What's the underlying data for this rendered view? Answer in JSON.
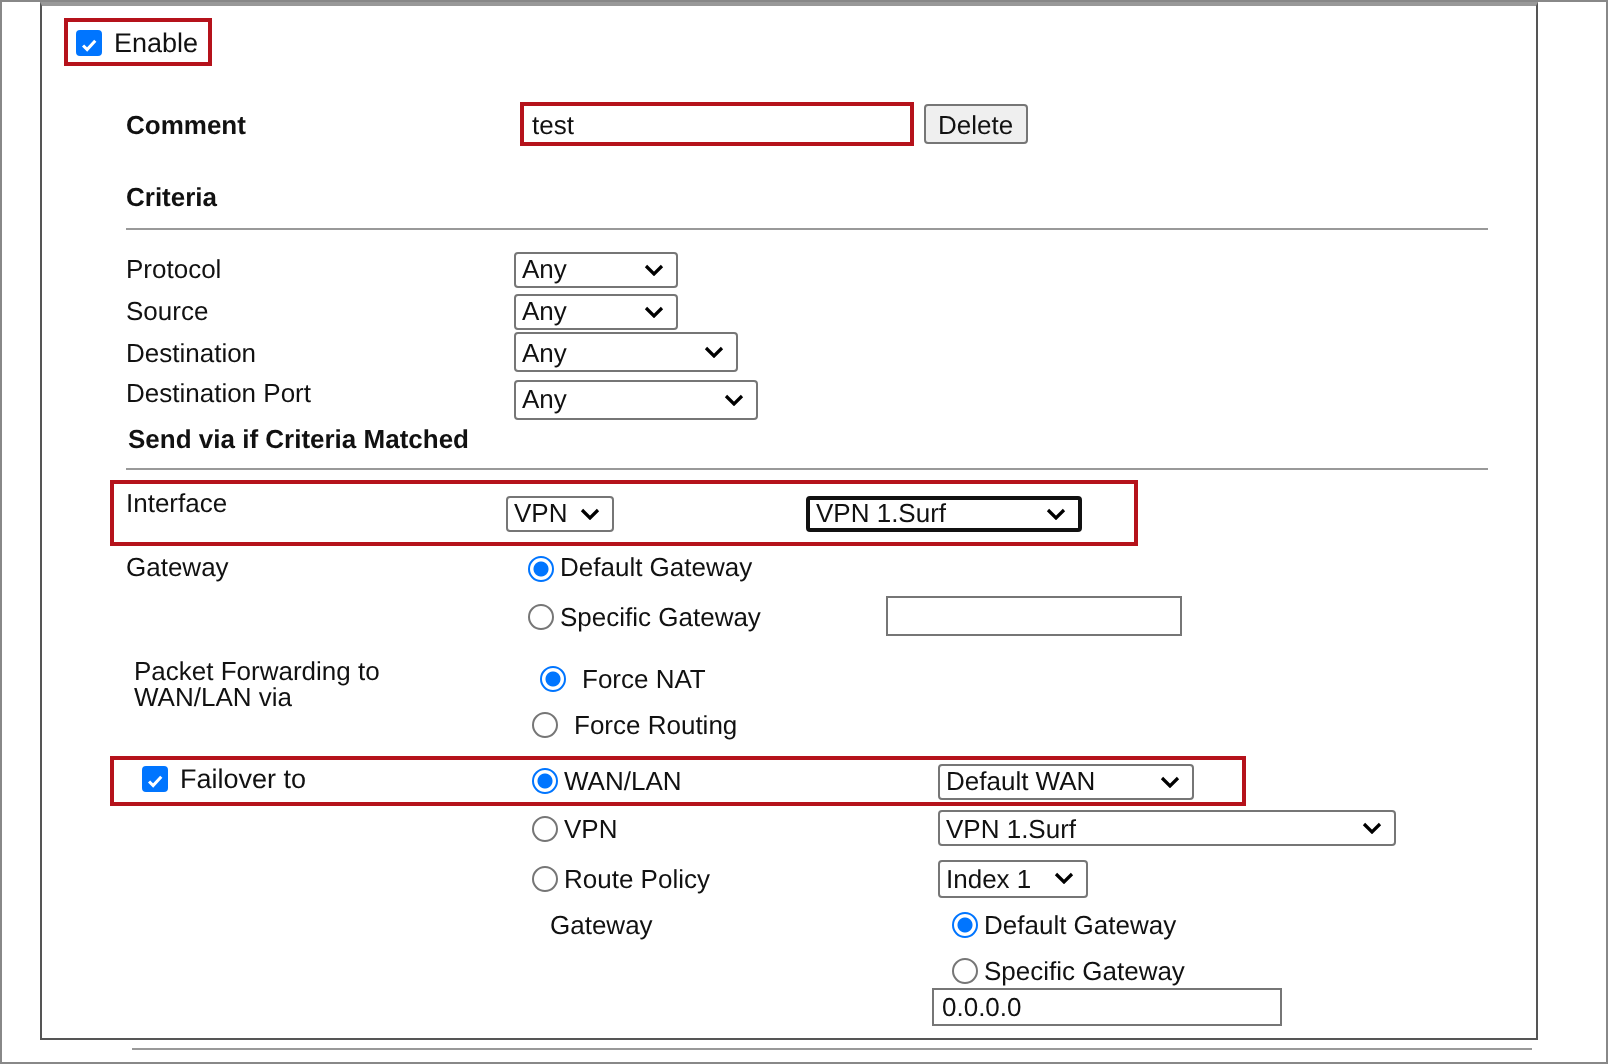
{
  "enable": {
    "label": "Enable",
    "checked": true,
    "highlighted": true
  },
  "comment": {
    "label": "Comment",
    "value": "test",
    "highlighted": true,
    "button": "Delete"
  },
  "criteria": {
    "heading": "Criteria",
    "fields": [
      {
        "label": "Protocol",
        "value": "Any"
      },
      {
        "label": "Source",
        "value": "Any"
      },
      {
        "label": "Destination",
        "value": "Any"
      },
      {
        "label": "Destination Port",
        "value": "Any"
      }
    ]
  },
  "send_via": {
    "heading": "Send via if Criteria Matched",
    "interface": {
      "label": "Interface",
      "type": "VPN",
      "target": "VPN 1.Surf",
      "target_focused": true,
      "highlighted": true
    },
    "gateway": {
      "label": "Gateway",
      "options": [
        {
          "label": "Default Gateway",
          "selected": true
        },
        {
          "label": "Specific Gateway",
          "selected": false
        }
      ]
    },
    "packet_forwarding": {
      "label": "Packet Forwarding to WAN/LAN via",
      "options": [
        {
          "label": "Force NAT",
          "selected": true
        },
        {
          "label": "Force Routing",
          "selected": false
        }
      ]
    },
    "failover": {
      "label": "Failover to",
      "checked": true,
      "highlighted": true,
      "options": [
        {
          "label": "WAN/LAN",
          "selected": true,
          "select": "Default WAN"
        },
        {
          "label": "VPN",
          "selected": false,
          "select": "VPN 1.Surf"
        },
        {
          "label": "Route Policy",
          "selected": false,
          "select": "Index 1"
        }
      ],
      "gateway": {
        "label": "Gateway",
        "options": [
          {
            "label": "Default Gateway",
            "selected": true
          },
          {
            "label": "Specific Gateway",
            "selected": false
          }
        ],
        "value": "0.0.0.0"
      }
    }
  }
}
